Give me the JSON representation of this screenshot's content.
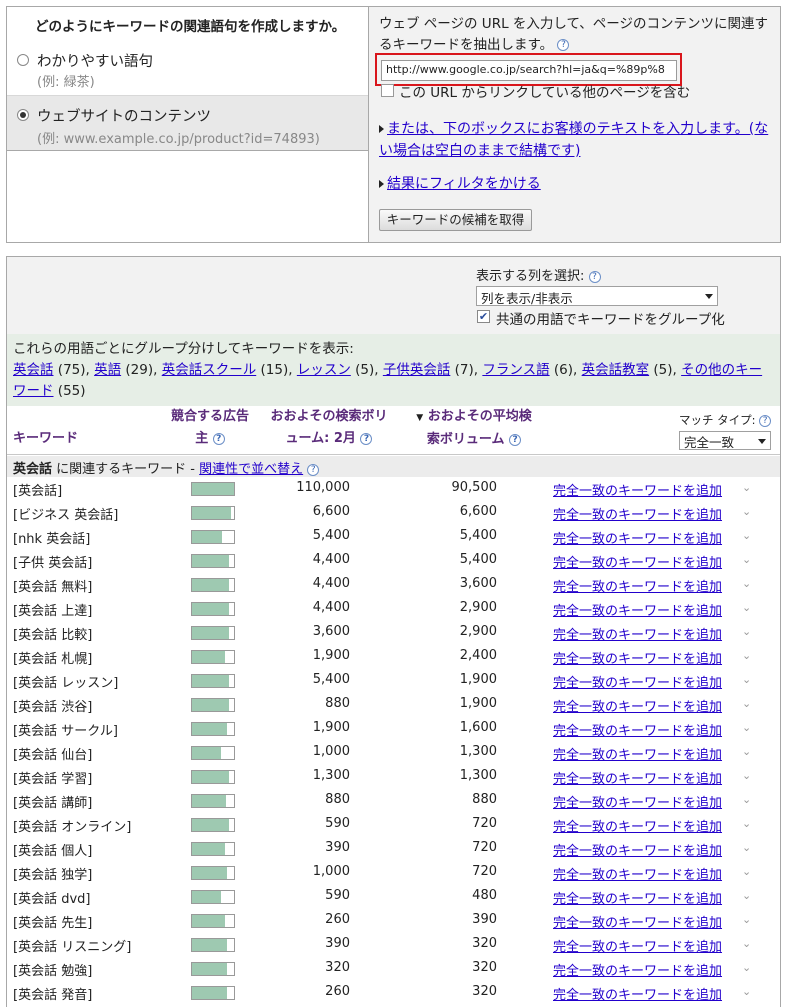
{
  "top_left": {
    "title": "どのようにキーワードの関連語句を作成しますか。",
    "option1_label": "わかりやすい語句",
    "option1_example": "(例: 緑茶)",
    "option2_label": "ウェブサイトのコンテンツ",
    "option2_example": "(例: www.example.co.jp/product?id=74893)"
  },
  "top_right": {
    "instruction": "ウェブ ページの URL を入力して、ページのコンテンツに関連するキーワードを抽出します。",
    "url_value": "http://www.google.co.jp/search?hl=ja&q=%89p%8",
    "links_checkbox_label": "この URL からリンクしている他のページを含む",
    "custom_text_link": "または、下のボックスにお客様のテキストを入力します。(ない場合は空白のままで結構です)",
    "filter_link": "結果にフィルタをかける",
    "get_button": "キーワードの候補を取得"
  },
  "columns": {
    "label": "表示する列を選択:",
    "select_value": "列を表示/非表示",
    "group_label": "共通の用語でキーワードをグループ化"
  },
  "groups": {
    "intro": "これらの用語ごとにグループ分けしてキーワードを表示:",
    "items": [
      {
        "term": "英会話",
        "count": "(75)"
      },
      {
        "term": "英語",
        "count": "(29)"
      },
      {
        "term": "英会話スクール",
        "count": "(15)"
      },
      {
        "term": "レッスン",
        "count": "(5)"
      },
      {
        "term": "子供英会話",
        "count": "(7)"
      },
      {
        "term": "フランス語",
        "count": "(6)"
      },
      {
        "term": "英会話教室",
        "count": "(5)"
      },
      {
        "term": "その他のキーワード",
        "count": "(55)"
      }
    ]
  },
  "table_header": {
    "keyword": "キーワード",
    "competition": "競合する広告主",
    "global_volume": "おおよその検索ボリューム: 2月",
    "local_volume": "おおよその平均検索ボリューム",
    "match_label": "マッチ タイプ:",
    "match_value": "完全一致"
  },
  "section": {
    "term": "英会話",
    "suffix": "に関連するキーワード - ",
    "sort_link": "関連性で並べ替え"
  },
  "rows": [
    {
      "keyword": "[英会話]",
      "competition": 1.0,
      "global": "110,000",
      "local": "90,500",
      "action": "完全一致のキーワードを追加"
    },
    {
      "keyword": "[ビジネス 英会話]",
      "competition": 0.93,
      "global": "6,600",
      "local": "6,600",
      "action": "完全一致のキーワードを追加"
    },
    {
      "keyword": "[nhk 英会話]",
      "competition": 0.72,
      "global": "5,400",
      "local": "5,400",
      "action": "完全一致のキーワードを追加"
    },
    {
      "keyword": "[子供 英会話]",
      "competition": 0.88,
      "global": "4,400",
      "local": "5,400",
      "action": "完全一致のキーワードを追加"
    },
    {
      "keyword": "[英会話 無料]",
      "competition": 0.88,
      "global": "4,400",
      "local": "3,600",
      "action": "完全一致のキーワードを追加"
    },
    {
      "keyword": "[英会話 上達]",
      "competition": 0.88,
      "global": "4,400",
      "local": "2,900",
      "action": "完全一致のキーワードを追加"
    },
    {
      "keyword": "[英会話 比較]",
      "competition": 0.88,
      "global": "3,600",
      "local": "2,900",
      "action": "完全一致のキーワードを追加"
    },
    {
      "keyword": "[英会話 札幌]",
      "competition": 0.78,
      "global": "1,900",
      "local": "2,400",
      "action": "完全一致のキーワードを追加"
    },
    {
      "keyword": "[英会話 レッスン]",
      "competition": 0.88,
      "global": "5,400",
      "local": "1,900",
      "action": "完全一致のキーワードを追加"
    },
    {
      "keyword": "[英会話 渋谷]",
      "competition": 0.88,
      "global": "880",
      "local": "1,900",
      "action": "完全一致のキーワードを追加"
    },
    {
      "keyword": "[英会話 サークル]",
      "competition": 0.83,
      "global": "1,900",
      "local": "1,600",
      "action": "完全一致のキーワードを追加"
    },
    {
      "keyword": "[英会話 仙台]",
      "competition": 0.68,
      "global": "1,000",
      "local": "1,300",
      "action": "完全一致のキーワードを追加"
    },
    {
      "keyword": "[英会話 学習]",
      "competition": 0.88,
      "global": "1,300",
      "local": "1,300",
      "action": "完全一致のキーワードを追加"
    },
    {
      "keyword": "[英会話 講師]",
      "competition": 0.8,
      "global": "880",
      "local": "880",
      "action": "完全一致のキーワードを追加"
    },
    {
      "keyword": "[英会話 オンライン]",
      "competition": 0.88,
      "global": "590",
      "local": "720",
      "action": "完全一致のキーワードを追加"
    },
    {
      "keyword": "[英会話 個人]",
      "competition": 0.78,
      "global": "390",
      "local": "720",
      "action": "完全一致のキーワードを追加"
    },
    {
      "keyword": "[英会話 独学]",
      "competition": 0.83,
      "global": "1,000",
      "local": "720",
      "action": "完全一致のキーワードを追加"
    },
    {
      "keyword": "[英会話 dvd]",
      "competition": 0.68,
      "global": "590",
      "local": "480",
      "action": "完全一致のキーワードを追加"
    },
    {
      "keyword": "[英会話 先生]",
      "competition": 0.78,
      "global": "260",
      "local": "390",
      "action": "完全一致のキーワードを追加"
    },
    {
      "keyword": "[英会話 リスニング]",
      "competition": 0.83,
      "global": "390",
      "local": "320",
      "action": "完全一致のキーワードを追加"
    },
    {
      "keyword": "[英会話 勉強]",
      "competition": 0.83,
      "global": "320",
      "local": "320",
      "action": "完全一致のキーワードを追加"
    },
    {
      "keyword": "[英会話 発音]",
      "competition": 0.83,
      "global": "260",
      "local": "320",
      "action": "完全一致のキーワードを追加"
    }
  ],
  "colors": {
    "link": "#2200cc",
    "header_text": "#5a2b7a",
    "competition_bar": "#9ec9b1",
    "highlight_border": "#d9161c",
    "group_background": "#e6eee6"
  }
}
